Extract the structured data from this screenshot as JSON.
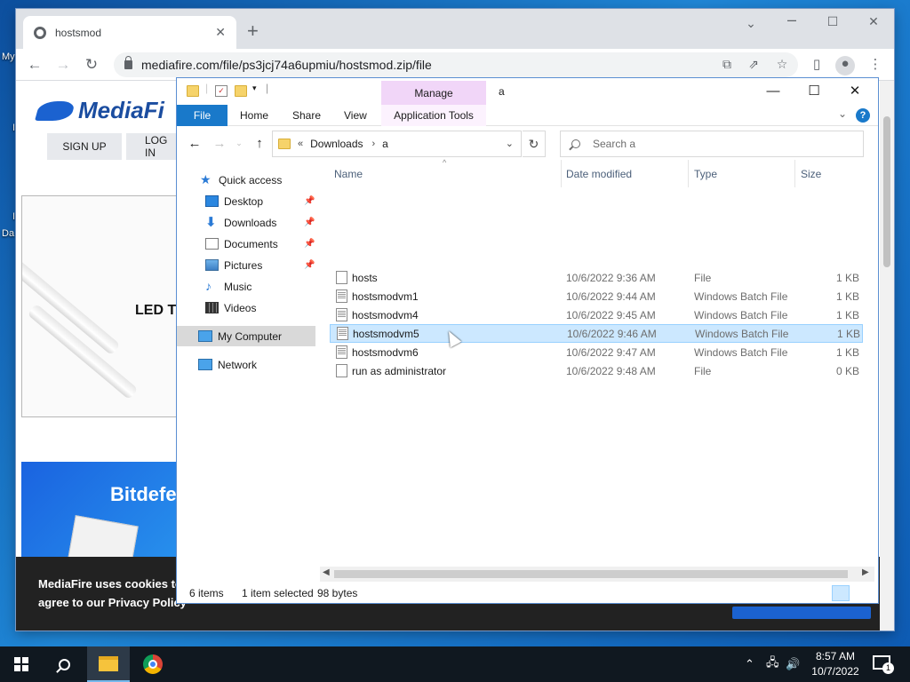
{
  "desktop": {
    "labels": [
      "My",
      "Da"
    ]
  },
  "chrome": {
    "tab_title": "hostsmod",
    "url": "mediafire.com/file/ps3jcj74a6upmiu/hostsmod.zip/file"
  },
  "mediafire": {
    "logo_text": "MediaFi",
    "signup_label": "SIGN UP",
    "login_label": "LOG IN",
    "ad1_text": "LED T",
    "ad2_text": "Bitdefe",
    "cookie_line1": "MediaFire uses cookies to",
    "cookie_line2": "agree to our Privacy Policy"
  },
  "explorer": {
    "title": "a",
    "manage_tab": "Manage",
    "ribbon": {
      "file": "File",
      "home": "Home",
      "share": "Share",
      "view": "View",
      "app_tools": "Application Tools"
    },
    "breadcrumb": [
      "Downloads",
      "a"
    ],
    "breadcrumb_overflow": "«",
    "search_placeholder": "Search a",
    "nav_pane": [
      {
        "label": "Quick access",
        "icon": "star-icon",
        "pinned": false
      },
      {
        "label": "Desktop",
        "icon": "desktop-icon",
        "pinned": true
      },
      {
        "label": "Downloads",
        "icon": "download-icon",
        "pinned": true
      },
      {
        "label": "Documents",
        "icon": "documents-icon",
        "pinned": true
      },
      {
        "label": "Pictures",
        "icon": "pictures-icon",
        "pinned": true
      },
      {
        "label": "Music",
        "icon": "music-icon",
        "pinned": false
      },
      {
        "label": "Videos",
        "icon": "videos-icon",
        "pinned": false
      },
      {
        "label": "My Computer",
        "icon": "computer-icon",
        "pinned": false,
        "selected": true
      },
      {
        "label": "Network",
        "icon": "network-icon",
        "pinned": false
      }
    ],
    "columns": {
      "name": "Name",
      "date": "Date modified",
      "type": "Type",
      "size": "Size"
    },
    "files": [
      {
        "name": "hosts",
        "date": "10/6/2022 9:36 AM",
        "type": "File",
        "size": "1 KB",
        "kind": "file"
      },
      {
        "name": "hostsmodvm1",
        "date": "10/6/2022 9:44 AM",
        "type": "Windows Batch File",
        "size": "1 KB",
        "kind": "bat"
      },
      {
        "name": "hostsmodvm4",
        "date": "10/6/2022 9:45 AM",
        "type": "Windows Batch File",
        "size": "1 KB",
        "kind": "bat"
      },
      {
        "name": "hostsmodvm5",
        "date": "10/6/2022 9:46 AM",
        "type": "Windows Batch File",
        "size": "1 KB",
        "kind": "bat",
        "selected": true
      },
      {
        "name": "hostsmodvm6",
        "date": "10/6/2022 9:47 AM",
        "type": "Windows Batch File",
        "size": "1 KB",
        "kind": "bat"
      },
      {
        "name": "run as administrator",
        "date": "10/6/2022 9:48 AM",
        "type": "File",
        "size": "0 KB",
        "kind": "file"
      }
    ],
    "status": {
      "items": "6 items",
      "selected": "1 item selected",
      "bytes": "98 bytes"
    }
  },
  "taskbar": {
    "time": "8:57 AM",
    "date": "10/7/2022",
    "notifications": "1"
  },
  "colors": {
    "accent": "#1979ca",
    "selection": "#cce8ff",
    "manage_tab": "#f1d6f8",
    "taskbar": "#101820"
  }
}
